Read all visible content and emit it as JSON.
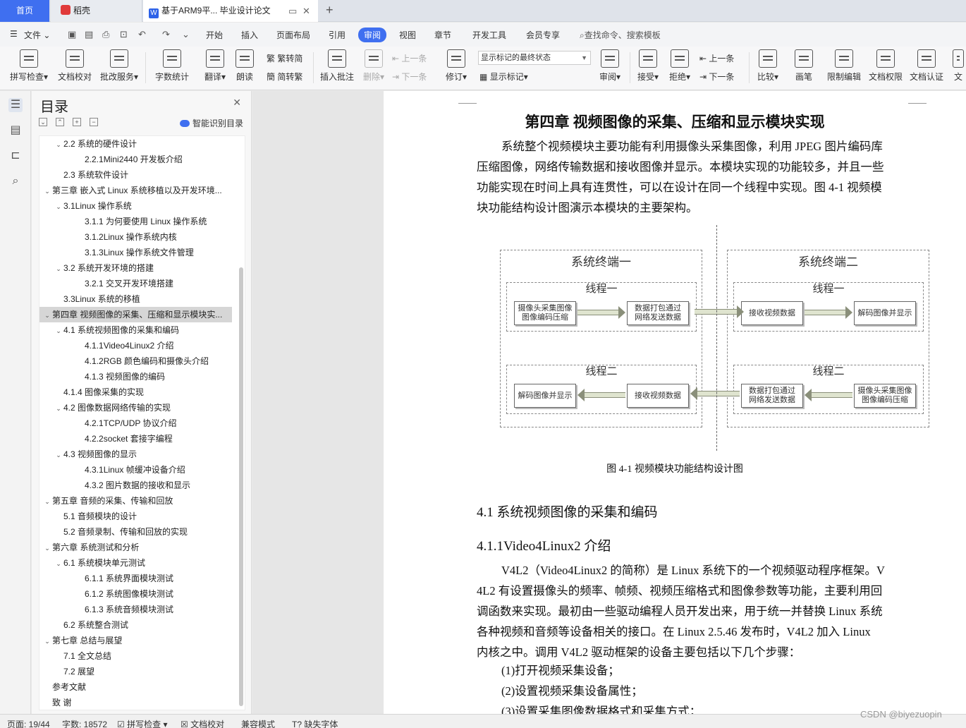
{
  "tabs": [
    {
      "label": "首页"
    },
    {
      "label": "稻壳"
    },
    {
      "label": "基于ARM9平... 毕业设计论文"
    }
  ],
  "menu": {
    "file": "文件",
    "items": [
      "开始",
      "插入",
      "页面布局",
      "引用",
      "审阅",
      "视图",
      "章节",
      "开发工具",
      "会员专享"
    ],
    "active": "审阅",
    "search": "查找命令、搜索模板"
  },
  "ribbon": {
    "spell_check": "拼写检查",
    "proofread": "文档校对",
    "annotate_service": "批改服务",
    "word_count": "字数统计",
    "translate": "翻译",
    "read_aloud": "朗读",
    "trad_to_simp": "繁转简",
    "simp_to_trad": "简转繁",
    "insert_comment": "插入批注",
    "delete": "删除",
    "prev_comment": "上一条",
    "next_comment": "下一条",
    "revise": "修订",
    "markup_state": "显示标记的最终状态",
    "show_markup": "显示标记",
    "review": "审阅",
    "accept": "接受",
    "reject": "拒绝",
    "prev_change": "上一条",
    "next_change": "下一条",
    "compare": "比较",
    "pen": "画笔",
    "restrict_edit": "限制编辑",
    "doc_permission": "文档权限",
    "doc_certify": "文档认证",
    "cut_label": "文"
  },
  "toc": {
    "title": "目录",
    "smart": "智能识别目录",
    "items": [
      {
        "text": "2.2 系统的硬件设计",
        "level": 2,
        "car": true
      },
      {
        "text": "2.2.1Mini2440 开发板介绍",
        "level": 3,
        "car": false
      },
      {
        "text": "2.3  系统软件设计",
        "level": 2,
        "car": false
      },
      {
        "text": "第三章  嵌入式 Linux 系统移植以及开发环境...",
        "level": 1,
        "car": true
      },
      {
        "text": "3.1Linux 操作系统",
        "level": 2,
        "car": true
      },
      {
        "text": "3.1.1 为何要使用 Linux 操作系统",
        "level": 3,
        "car": false
      },
      {
        "text": "3.1.2Linux 操作系统内核",
        "level": 3,
        "car": false
      },
      {
        "text": "3.1.3Linux 操作系统文件管理",
        "level": 3,
        "car": false
      },
      {
        "text": "3.2  系统开发环境的搭建",
        "level": 2,
        "car": true
      },
      {
        "text": "3.2.1 交叉开发环境搭建",
        "level": 3,
        "car": false
      },
      {
        "text": "3.3Linux 系统的移植",
        "level": 2,
        "car": false
      },
      {
        "text": "第四章  视频图像的采集、压缩和显示模块实...",
        "level": 1,
        "car": true,
        "sel": true
      },
      {
        "text": "4.1 系统视频图像的采集和编码",
        "level": 2,
        "car": true
      },
      {
        "text": "4.1.1Video4Linux2 介绍",
        "level": 3,
        "car": false
      },
      {
        "text": "4.1.2RGB 颜色编码和摄像头介绍",
        "level": 3,
        "car": false
      },
      {
        "text": "4.1.3 视频图像的编码",
        "level": 3,
        "car": false
      },
      {
        "text": "4.1.4 图像采集的实现",
        "level": 2,
        "car": false
      },
      {
        "text": "4.2 图像数据网络传输的实现",
        "level": 2,
        "car": true
      },
      {
        "text": "4.2.1TCP/UDP 协议介绍",
        "level": 3,
        "car": false
      },
      {
        "text": "4.2.2socket 套接字编程",
        "level": 3,
        "car": false
      },
      {
        "text": "4.3 视频图像的显示",
        "level": 2,
        "car": true
      },
      {
        "text": "4.3.1Linux 帧缓冲设备介绍",
        "level": 3,
        "car": false
      },
      {
        "text": "4.3.2 图片数据的接收和显示",
        "level": 3,
        "car": false
      },
      {
        "text": "第五章  音频的采集、传输和回放",
        "level": 1,
        "car": true
      },
      {
        "text": "5.1 音频模块的设计",
        "level": 2,
        "car": false
      },
      {
        "text": "5.2 音频录制、传输和回放的实现",
        "level": 2,
        "car": false
      },
      {
        "text": "第六章  系统测试和分析",
        "level": 1,
        "car": true
      },
      {
        "text": "6.1 系统模块单元测试",
        "level": 2,
        "car": true
      },
      {
        "text": "6.1.1  系统界面模块测试",
        "level": 3,
        "car": false
      },
      {
        "text": "6.1.2 系统图像模块测试",
        "level": 3,
        "car": false
      },
      {
        "text": "6.1.3 系统音频模块测试",
        "level": 3,
        "car": false
      },
      {
        "text": "6.2 系统整合测试",
        "level": 2,
        "car": false
      },
      {
        "text": "第七章  总结与展望",
        "level": 1,
        "car": true
      },
      {
        "text": "7.1 全文总结",
        "level": 2,
        "car": false
      },
      {
        "text": "7.2 展望",
        "level": 2,
        "car": false
      },
      {
        "text": "参考文献",
        "level": 1,
        "car": false
      },
      {
        "text": "致    谢",
        "level": 1,
        "car": false
      }
    ]
  },
  "doc": {
    "chapter_title": "第四章    视频图像的采集、压缩和显示模块实现",
    "intro_lines": [
      "系统整个视频模块主要功能有利用摄像头采集图像，利用 JPEG 图片编码库",
      "压缩图像，网络传输数据和接收图像并显示。本模块实现的功能较多，并且一些",
      "功能实现在时间上具有连贯性，可以在设计在同一个线程中实现。图 4-1 视频模",
      "块功能结构设计图演示本模块的主要架构。"
    ],
    "diagram": {
      "terminal1": "系统终端一",
      "terminal2": "系统终端二",
      "thread1": "线程一",
      "thread2": "线程二",
      "capture_encode": "摄像头采集图像\n图像编码压缩",
      "pack_send": "数据打包通过\n网络发送数据",
      "recv_data": "接收视频数据",
      "decode_show": "解码图像并显示"
    },
    "caption": "图 4-1    视频模块功能结构设计图",
    "h2": "4.1 系统视频图像的采集和编码",
    "h3": "4.1.1Video4Linux2 介绍",
    "v4l2_lines": [
      "V4L2（Video4Linux2 的简称）是 Linux 系统下的一个视频驱动程序框架。V",
      "4L2 有设置摄像头的频率、帧频、视频压缩格式和图像参数等功能，主要利用回",
      "调函数来实现。最初由一些驱动编程人员开发出来，用于统一并替换 Linux 系统",
      "各种视频和音频等设备相关的接口。在 Linux  2.5.46 发布时，V4L2 加入 Linux",
      "内核之中。调用 V4L2 驱动框架的设备主要包括以下几个步骤："
    ],
    "steps": [
      "(1)打开视频采集设备；",
      "(2)设置视频采集设备属性；",
      "(3)设置采集图像数据格式和采集方式；"
    ]
  },
  "status": {
    "page": "页面: 19/44",
    "words": "字数: 18572",
    "spell": "拼写检查",
    "proof": "文档校对",
    "compat": "兼容模式",
    "missing_font": "缺失字体"
  },
  "watermark": "CSDN @biyezuopin"
}
